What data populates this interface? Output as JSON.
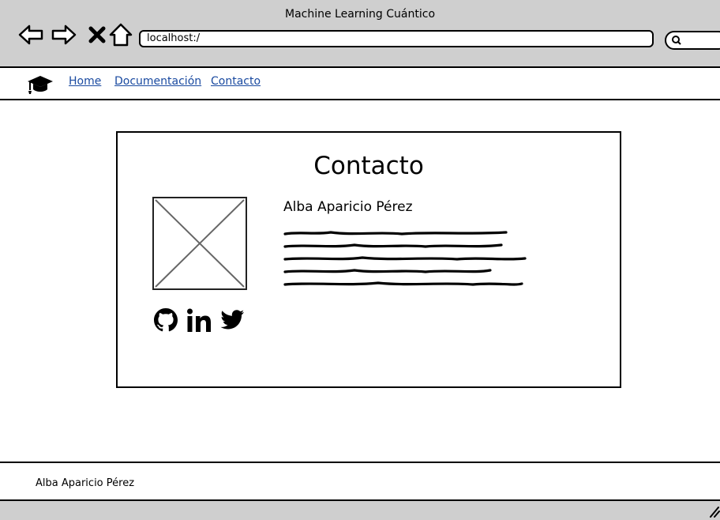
{
  "window": {
    "title": "Machine Learning Cuántico",
    "address": "localhost:/"
  },
  "toolbar": {
    "icons": [
      "back-icon",
      "forward-icon",
      "close-icon",
      "home-icon",
      "search-icon"
    ]
  },
  "navbar": {
    "brand_icon": "graduation-cap-icon",
    "links": [
      "Home",
      "Documentación",
      "Contacto"
    ]
  },
  "contact": {
    "title": "Contacto",
    "name": "Alba Aparicio Pérez",
    "image": "image-placeholder",
    "social_icons": [
      "github-icon",
      "linkedin-icon",
      "twitter-icon"
    ]
  },
  "footer": {
    "text": "Alba Aparicio Pérez"
  },
  "colors": {
    "chrome": "#cfcfcf",
    "link": "#1a4aa0"
  }
}
